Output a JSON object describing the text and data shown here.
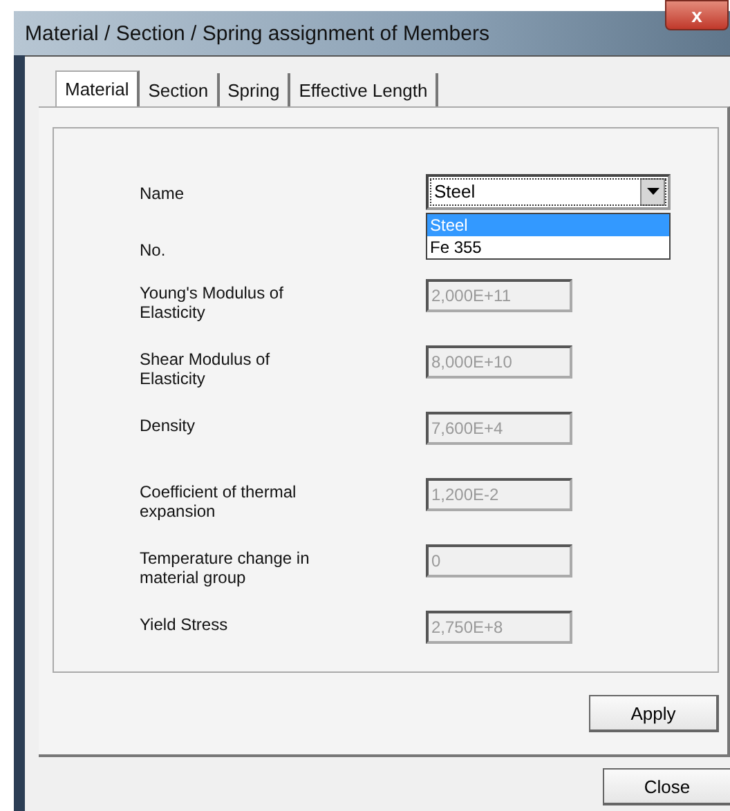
{
  "window": {
    "title": "Material / Section / Spring assignment of Members",
    "close_glyph": "x"
  },
  "tabs": [
    {
      "label": "Material",
      "selected": true
    },
    {
      "label": "Section",
      "selected": false
    },
    {
      "label": "Spring",
      "selected": false
    },
    {
      "label": "Effective Length",
      "selected": false
    }
  ],
  "name_field": {
    "label": "Name",
    "value": "Steel",
    "expanded": true,
    "options": [
      {
        "label": "Steel",
        "selected": true
      },
      {
        "label": "Fe 355",
        "selected": false
      }
    ]
  },
  "number_label": "No.",
  "properties": [
    {
      "label": "Young's Modulus of Elasticity",
      "value": "2,000E+11",
      "disabled": true
    },
    {
      "label": "Shear Modulus of Elasticity",
      "value": "8,000E+10",
      "disabled": true
    },
    {
      "label": "Density",
      "value": "7,600E+4",
      "disabled": true
    },
    {
      "label": "Coefficient of thermal expansion",
      "value": "1,200E-2",
      "disabled": true
    },
    {
      "label": "Temperature change in material group",
      "value": "0",
      "disabled": true
    },
    {
      "label": "Yield Stress",
      "value": "2,750E+8",
      "disabled": true
    }
  ],
  "buttons": {
    "apply": "Apply",
    "close": "Close"
  }
}
